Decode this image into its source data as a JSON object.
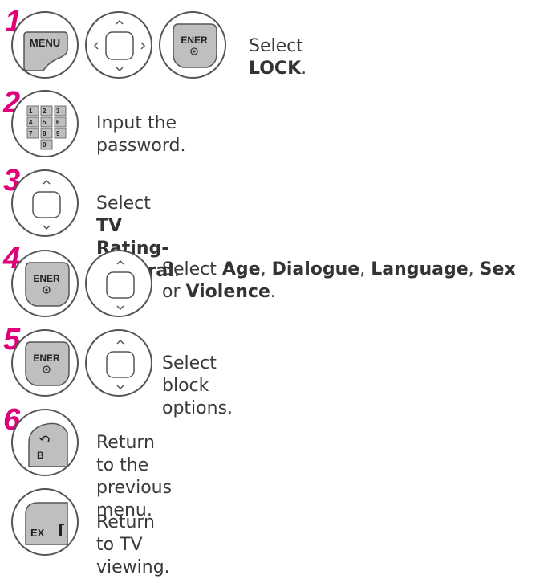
{
  "steps": [
    {
      "number": "1",
      "text_pre": "Select ",
      "bold": [
        "LOCK"
      ],
      "text_post": ".",
      "keys": [
        "menu-key",
        "nav-key",
        "enter-key"
      ]
    },
    {
      "number": "2",
      "text": "Input the password.",
      "keys": [
        "number-keypad"
      ]
    },
    {
      "number": "3",
      "text_pre": "Select ",
      "bold": [
        "TV Rating-General"
      ],
      "text_post": ".",
      "keys": [
        "up-down-key"
      ]
    },
    {
      "number": "4",
      "line1_pre": "Select ",
      "bold": [
        "Age",
        "Dialogue",
        "Language",
        "Sex",
        "Violence"
      ],
      "sep1": ", ",
      "line2_pre": "or ",
      "text_post": ".",
      "keys": [
        "enter-key",
        "up-down-key"
      ]
    },
    {
      "number": "5",
      "text": "Select block options.",
      "keys": [
        "enter-key",
        "up-down-key"
      ]
    },
    {
      "number": "6",
      "text": "Return to the previous menu.",
      "keys": [
        "back-key"
      ]
    },
    {
      "number": "",
      "text": "Return to TV viewing.",
      "keys": [
        "exit-key"
      ]
    }
  ],
  "key_labels": {
    "menu": "MENU",
    "enter": "ENER",
    "exit": "EX",
    "back": "B",
    "keypad": [
      "1",
      "2",
      "3",
      "4",
      "5",
      "6",
      "7",
      "8",
      "9",
      "0"
    ]
  },
  "colors": {
    "step_number": "#e0007a",
    "key_outline": "#555555",
    "key_fill": "#bfbfbf"
  }
}
